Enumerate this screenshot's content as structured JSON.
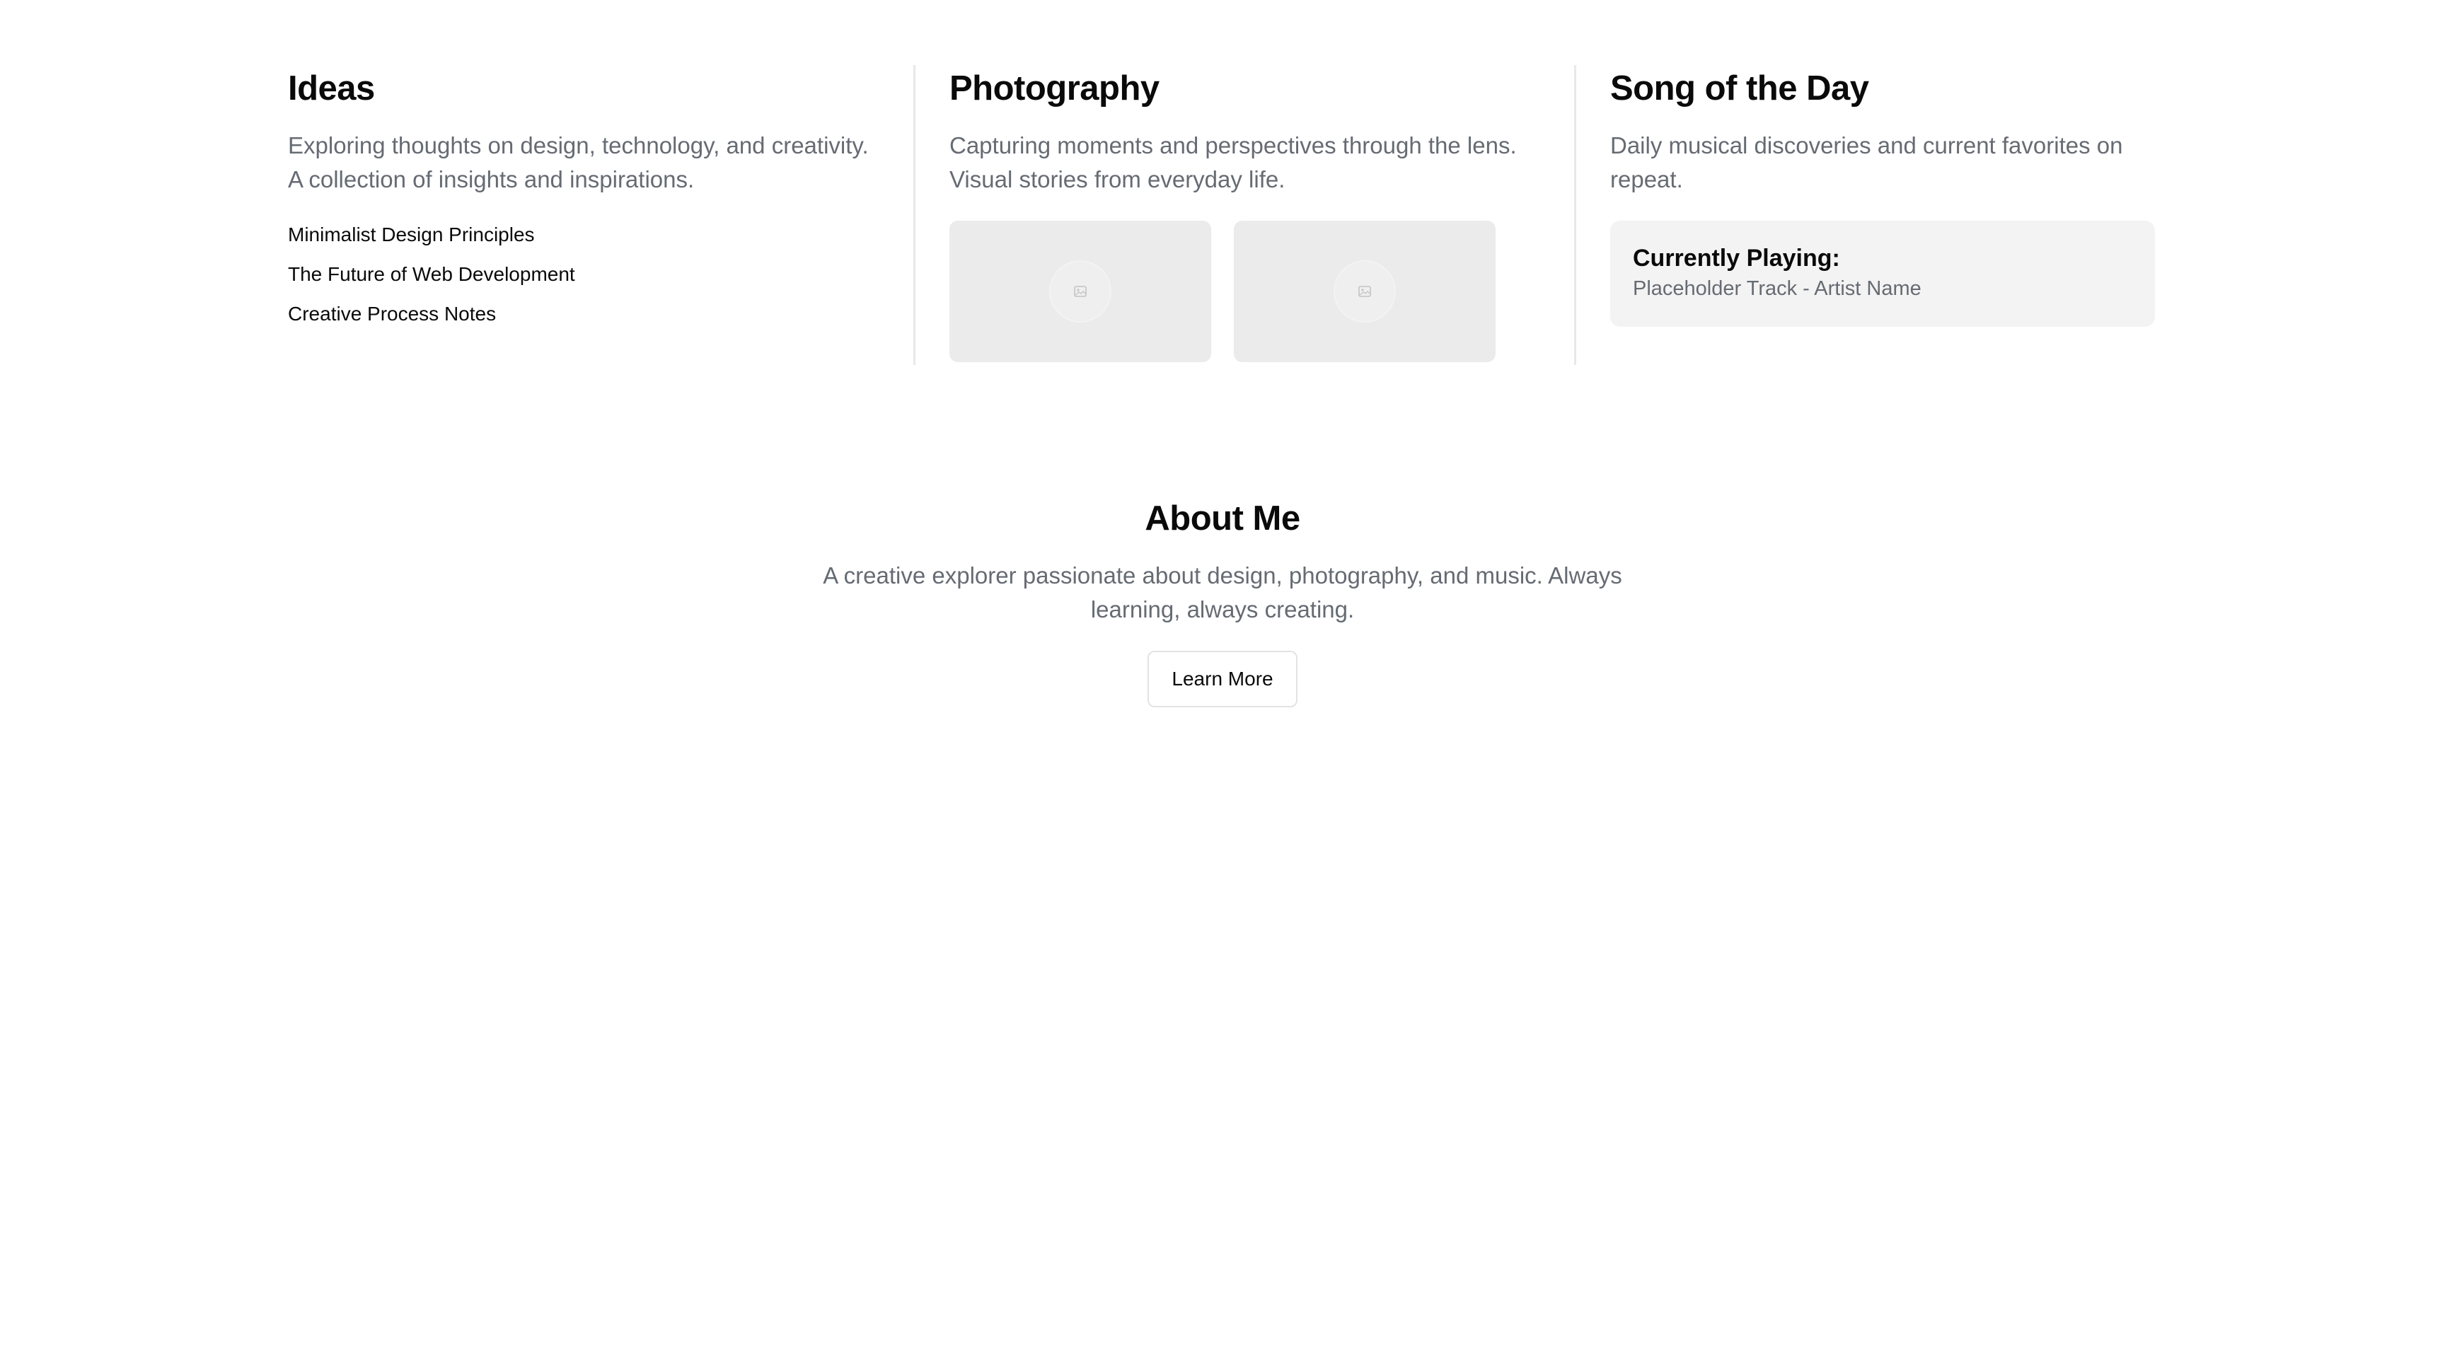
{
  "ideas": {
    "title": "Ideas",
    "description": "Exploring thoughts on design, technology, and creativity. A collection of insights and inspirations.",
    "links": [
      "Minimalist Design Principles",
      "The Future of Web Development",
      "Creative Process Notes"
    ]
  },
  "photography": {
    "title": "Photography",
    "description": "Capturing moments and perspectives through the lens. Visual stories from everyday life.",
    "placeholders": [
      {
        "icon": "image-placeholder-icon"
      },
      {
        "icon": "image-placeholder-icon"
      }
    ]
  },
  "song": {
    "title": "Song of the Day",
    "description": "Daily musical discoveries and current favorites on repeat.",
    "now_playing_label": "Currently Playing:",
    "track": "Placeholder Track - Artist Name"
  },
  "about": {
    "title": "About Me",
    "description": "A creative explorer passionate about design, photography, and music. Always learning, always creating.",
    "button_label": "Learn More"
  },
  "colors": {
    "text": "#0a0a0a",
    "muted": "#666b73",
    "divider": "#e8e8e8",
    "placeholder_bg": "#ebebeb",
    "card_bg": "#f3f3f3"
  }
}
